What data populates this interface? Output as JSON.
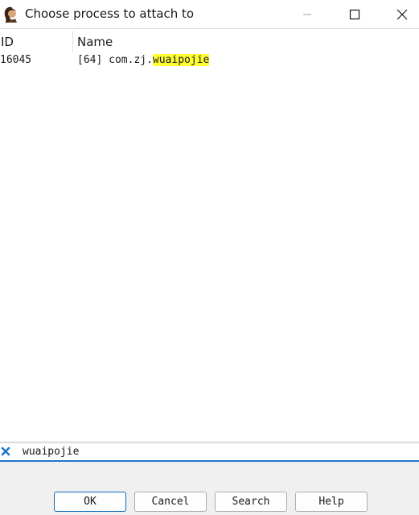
{
  "window": {
    "title": "Choose process to attach to"
  },
  "list": {
    "columns": [
      "ID",
      "Name"
    ],
    "rows": [
      {
        "id": "16045",
        "name_prefix": "[64] com.zj.",
        "name_match": "wuaipojie"
      }
    ]
  },
  "filter": {
    "value": "wuaipojie"
  },
  "buttons": {
    "ok": "OK",
    "cancel": "Cancel",
    "search": "Search",
    "help": "Help"
  },
  "colors": {
    "highlight": "#ffff33",
    "focus_accent": "#1f77c8",
    "clear_icon": "#1f77c8"
  }
}
